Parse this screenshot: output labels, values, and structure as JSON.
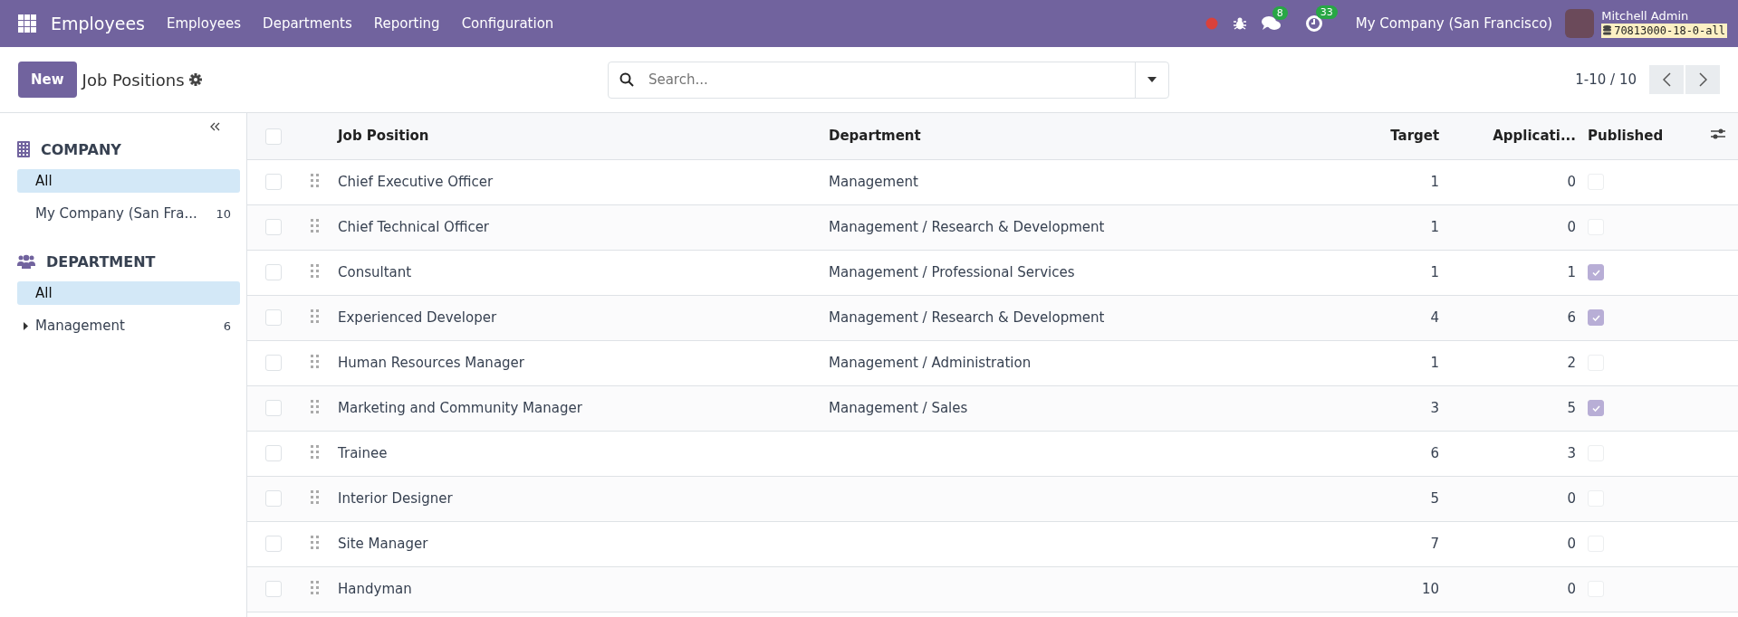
{
  "navbar": {
    "app_name": "Employees",
    "menu": [
      "Employees",
      "Departments",
      "Reporting",
      "Configuration"
    ],
    "messages_count": "8",
    "activities_count": "33",
    "company": "My Company (San Francisco)",
    "user_name": "Mitchell Admin",
    "database": "70813000-18-0-all"
  },
  "control_panel": {
    "new_button": "New",
    "title": "Job Positions",
    "search": {
      "placeholder": "Search..."
    },
    "pager": "1-10 / 10"
  },
  "sidebar": {
    "sections": [
      {
        "kind": "company",
        "title": "COMPANY",
        "items": [
          {
            "label": "All",
            "selected": true,
            "expandable": false
          },
          {
            "label": "My Company (San Fra...",
            "count": "10",
            "selected": false,
            "expandable": false
          }
        ]
      },
      {
        "kind": "department",
        "title": "DEPARTMENT",
        "items": [
          {
            "label": "All",
            "selected": true,
            "expandable": false
          },
          {
            "label": "Management",
            "count": "6",
            "selected": false,
            "expandable": true
          }
        ]
      }
    ]
  },
  "table": {
    "all_selected": false,
    "columns": [
      "Job Position",
      "Department",
      "Target",
      "Applicati...",
      "Published"
    ],
    "rows": [
      {
        "selected": false,
        "job": "Chief Executive Officer",
        "department": "Management",
        "target": "1",
        "applications": "0",
        "published": false
      },
      {
        "selected": false,
        "job": "Chief Technical Officer",
        "department": "Management / Research & Development",
        "target": "1",
        "applications": "0",
        "published": false
      },
      {
        "selected": false,
        "job": "Consultant",
        "department": "Management / Professional Services",
        "target": "1",
        "applications": "1",
        "published": true
      },
      {
        "selected": false,
        "job": "Experienced Developer",
        "department": "Management / Research & Development",
        "target": "4",
        "applications": "6",
        "published": true
      },
      {
        "selected": false,
        "job": "Human Resources Manager",
        "department": "Management / Administration",
        "target": "1",
        "applications": "2",
        "published": false
      },
      {
        "selected": false,
        "job": "Marketing and Community Manager",
        "department": "Management / Sales",
        "target": "3",
        "applications": "5",
        "published": true
      },
      {
        "selected": false,
        "job": "Trainee",
        "target": "6",
        "applications": "3",
        "published": false
      },
      {
        "selected": false,
        "job": "Interior Designer",
        "target": "5",
        "applications": "0",
        "published": false
      },
      {
        "selected": false,
        "job": "Site Manager",
        "target": "7",
        "applications": "0",
        "published": false
      },
      {
        "selected": false,
        "job": "Handyman",
        "target": "10",
        "applications": "0",
        "published": false
      }
    ]
  }
}
